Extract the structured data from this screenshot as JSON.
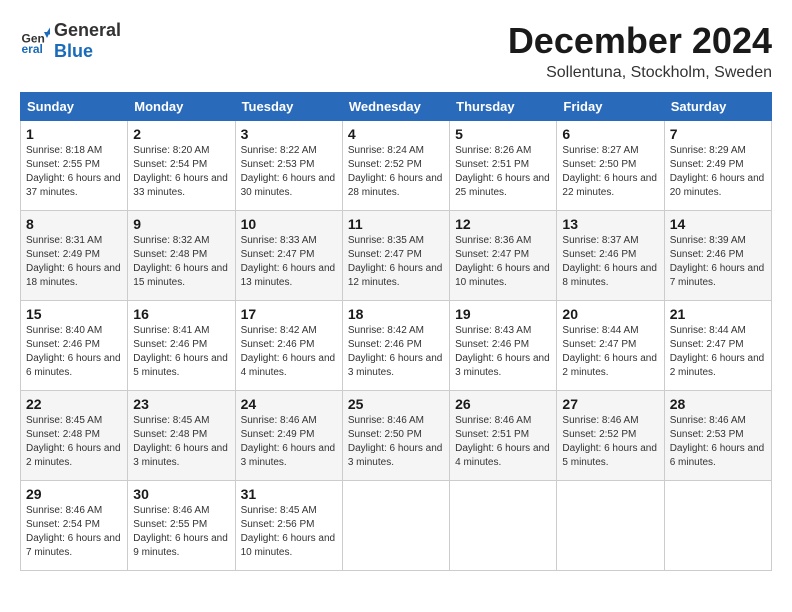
{
  "header": {
    "logo_general": "General",
    "logo_blue": "Blue",
    "month_title": "December 2024",
    "location": "Sollentuna, Stockholm, Sweden"
  },
  "days_of_week": [
    "Sunday",
    "Monday",
    "Tuesday",
    "Wednesday",
    "Thursday",
    "Friday",
    "Saturday"
  ],
  "weeks": [
    [
      {
        "day": "1",
        "sunrise": "8:18 AM",
        "sunset": "2:55 PM",
        "daylight": "6 hours and 37 minutes."
      },
      {
        "day": "2",
        "sunrise": "8:20 AM",
        "sunset": "2:54 PM",
        "daylight": "6 hours and 33 minutes."
      },
      {
        "day": "3",
        "sunrise": "8:22 AM",
        "sunset": "2:53 PM",
        "daylight": "6 hours and 30 minutes."
      },
      {
        "day": "4",
        "sunrise": "8:24 AM",
        "sunset": "2:52 PM",
        "daylight": "6 hours and 28 minutes."
      },
      {
        "day": "5",
        "sunrise": "8:26 AM",
        "sunset": "2:51 PM",
        "daylight": "6 hours and 25 minutes."
      },
      {
        "day": "6",
        "sunrise": "8:27 AM",
        "sunset": "2:50 PM",
        "daylight": "6 hours and 22 minutes."
      },
      {
        "day": "7",
        "sunrise": "8:29 AM",
        "sunset": "2:49 PM",
        "daylight": "6 hours and 20 minutes."
      }
    ],
    [
      {
        "day": "8",
        "sunrise": "8:31 AM",
        "sunset": "2:49 PM",
        "daylight": "6 hours and 18 minutes."
      },
      {
        "day": "9",
        "sunrise": "8:32 AM",
        "sunset": "2:48 PM",
        "daylight": "6 hours and 15 minutes."
      },
      {
        "day": "10",
        "sunrise": "8:33 AM",
        "sunset": "2:47 PM",
        "daylight": "6 hours and 13 minutes."
      },
      {
        "day": "11",
        "sunrise": "8:35 AM",
        "sunset": "2:47 PM",
        "daylight": "6 hours and 12 minutes."
      },
      {
        "day": "12",
        "sunrise": "8:36 AM",
        "sunset": "2:47 PM",
        "daylight": "6 hours and 10 minutes."
      },
      {
        "day": "13",
        "sunrise": "8:37 AM",
        "sunset": "2:46 PM",
        "daylight": "6 hours and 8 minutes."
      },
      {
        "day": "14",
        "sunrise": "8:39 AM",
        "sunset": "2:46 PM",
        "daylight": "6 hours and 7 minutes."
      }
    ],
    [
      {
        "day": "15",
        "sunrise": "8:40 AM",
        "sunset": "2:46 PM",
        "daylight": "6 hours and 6 minutes."
      },
      {
        "day": "16",
        "sunrise": "8:41 AM",
        "sunset": "2:46 PM",
        "daylight": "6 hours and 5 minutes."
      },
      {
        "day": "17",
        "sunrise": "8:42 AM",
        "sunset": "2:46 PM",
        "daylight": "6 hours and 4 minutes."
      },
      {
        "day": "18",
        "sunrise": "8:42 AM",
        "sunset": "2:46 PM",
        "daylight": "6 hours and 3 minutes."
      },
      {
        "day": "19",
        "sunrise": "8:43 AM",
        "sunset": "2:46 PM",
        "daylight": "6 hours and 3 minutes."
      },
      {
        "day": "20",
        "sunrise": "8:44 AM",
        "sunset": "2:47 PM",
        "daylight": "6 hours and 2 minutes."
      },
      {
        "day": "21",
        "sunrise": "8:44 AM",
        "sunset": "2:47 PM",
        "daylight": "6 hours and 2 minutes."
      }
    ],
    [
      {
        "day": "22",
        "sunrise": "8:45 AM",
        "sunset": "2:48 PM",
        "daylight": "6 hours and 2 minutes."
      },
      {
        "day": "23",
        "sunrise": "8:45 AM",
        "sunset": "2:48 PM",
        "daylight": "6 hours and 3 minutes."
      },
      {
        "day": "24",
        "sunrise": "8:46 AM",
        "sunset": "2:49 PM",
        "daylight": "6 hours and 3 minutes."
      },
      {
        "day": "25",
        "sunrise": "8:46 AM",
        "sunset": "2:50 PM",
        "daylight": "6 hours and 3 minutes."
      },
      {
        "day": "26",
        "sunrise": "8:46 AM",
        "sunset": "2:51 PM",
        "daylight": "6 hours and 4 minutes."
      },
      {
        "day": "27",
        "sunrise": "8:46 AM",
        "sunset": "2:52 PM",
        "daylight": "6 hours and 5 minutes."
      },
      {
        "day": "28",
        "sunrise": "8:46 AM",
        "sunset": "2:53 PM",
        "daylight": "6 hours and 6 minutes."
      }
    ],
    [
      {
        "day": "29",
        "sunrise": "8:46 AM",
        "sunset": "2:54 PM",
        "daylight": "6 hours and 7 minutes."
      },
      {
        "day": "30",
        "sunrise": "8:46 AM",
        "sunset": "2:55 PM",
        "daylight": "6 hours and 9 minutes."
      },
      {
        "day": "31",
        "sunrise": "8:45 AM",
        "sunset": "2:56 PM",
        "daylight": "6 hours and 10 minutes."
      },
      null,
      null,
      null,
      null
    ]
  ]
}
